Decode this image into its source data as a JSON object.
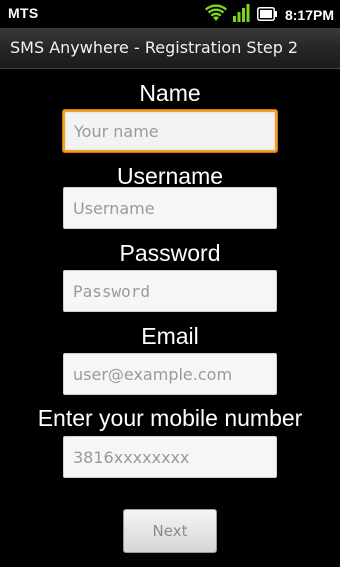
{
  "status_bar": {
    "carrier": "MTS",
    "time": "8:17PM",
    "icons": [
      "wifi-icon",
      "signal-icon",
      "battery-icon"
    ],
    "accent_color": "#7ed321"
  },
  "title_bar": {
    "title": "SMS Anywhere - Registration Step 2"
  },
  "form": {
    "name": {
      "label": "Name",
      "placeholder": "Your name",
      "value": ""
    },
    "username": {
      "label": "Username",
      "placeholder": "Username",
      "value": ""
    },
    "password": {
      "label": "Password",
      "placeholder": "Password",
      "value": ""
    },
    "email": {
      "label": "Email",
      "placeholder": "user@example.com",
      "value": ""
    },
    "mobile": {
      "label": "Enter your mobile number",
      "placeholder": "3816xxxxxxxx",
      "value": ""
    },
    "next_label": "Next",
    "focus_color": "#f5a021"
  }
}
